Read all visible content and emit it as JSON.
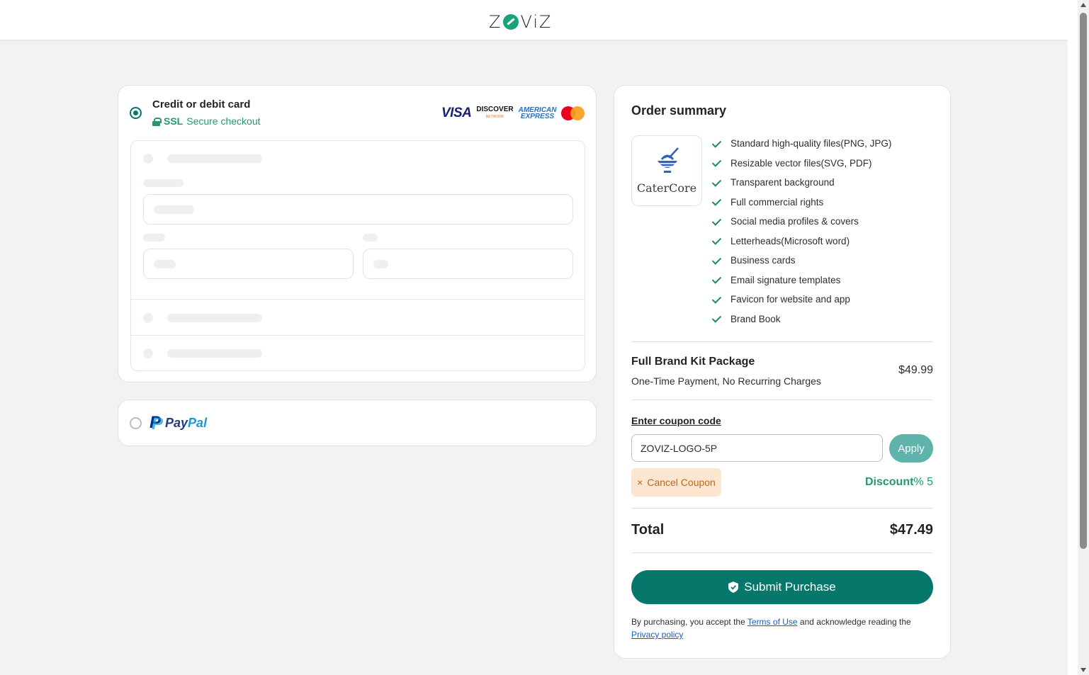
{
  "header": {
    "logo": "ZOVIZ"
  },
  "payment": {
    "credit": {
      "title": "Credit or debit card",
      "ssl_bold": "SSL",
      "ssl_text": "Secure checkout",
      "brands": {
        "visa": "VISA",
        "discover": "DISCOVER",
        "discover_sub": "NETWORK",
        "amex_1": "AMERICAN",
        "amex_2": "EXPRESS"
      }
    },
    "paypal": {
      "label_a": "Pay",
      "label_b": "Pal"
    }
  },
  "summary": {
    "title": "Order summary",
    "brand_name": "CaterCore",
    "features": [
      "Standard high-quality files(PNG, JPG)",
      "Resizable vector files(SVG, PDF)",
      "Transparent background",
      "Full commercial rights",
      "Social media profiles & covers",
      "Letterheads(Microsoft word)",
      "Business cards",
      "Email signature templates",
      "Favicon for website and app",
      "Brand Book"
    ],
    "package_name": "Full Brand Kit Package",
    "package_sub": "One-Time Payment, No Recurring Charges",
    "package_price": "$49.99",
    "coupon_label": "Enter coupon code",
    "coupon_value": "ZOVIZ-LOGO-5P",
    "apply_label": "Apply",
    "cancel_coupon_label": "Cancel Coupon",
    "discount_label": "Discount",
    "discount_value": "% 5",
    "total_label": "Total",
    "total_value": "$47.49",
    "submit_label": "Submit Purchase",
    "legal_prefix": "By purchasing, you accept the ",
    "terms_link": "Terms of Use",
    "legal_middle": " and acknowledge reading the",
    "privacy_link": "Privacy policy"
  },
  "colors": {
    "accent": "#08776b",
    "accent_light": "#5fb3ab",
    "success": "#1f9a72",
    "cancel_bg": "#fde6cf",
    "cancel_text": "#c0661a"
  }
}
